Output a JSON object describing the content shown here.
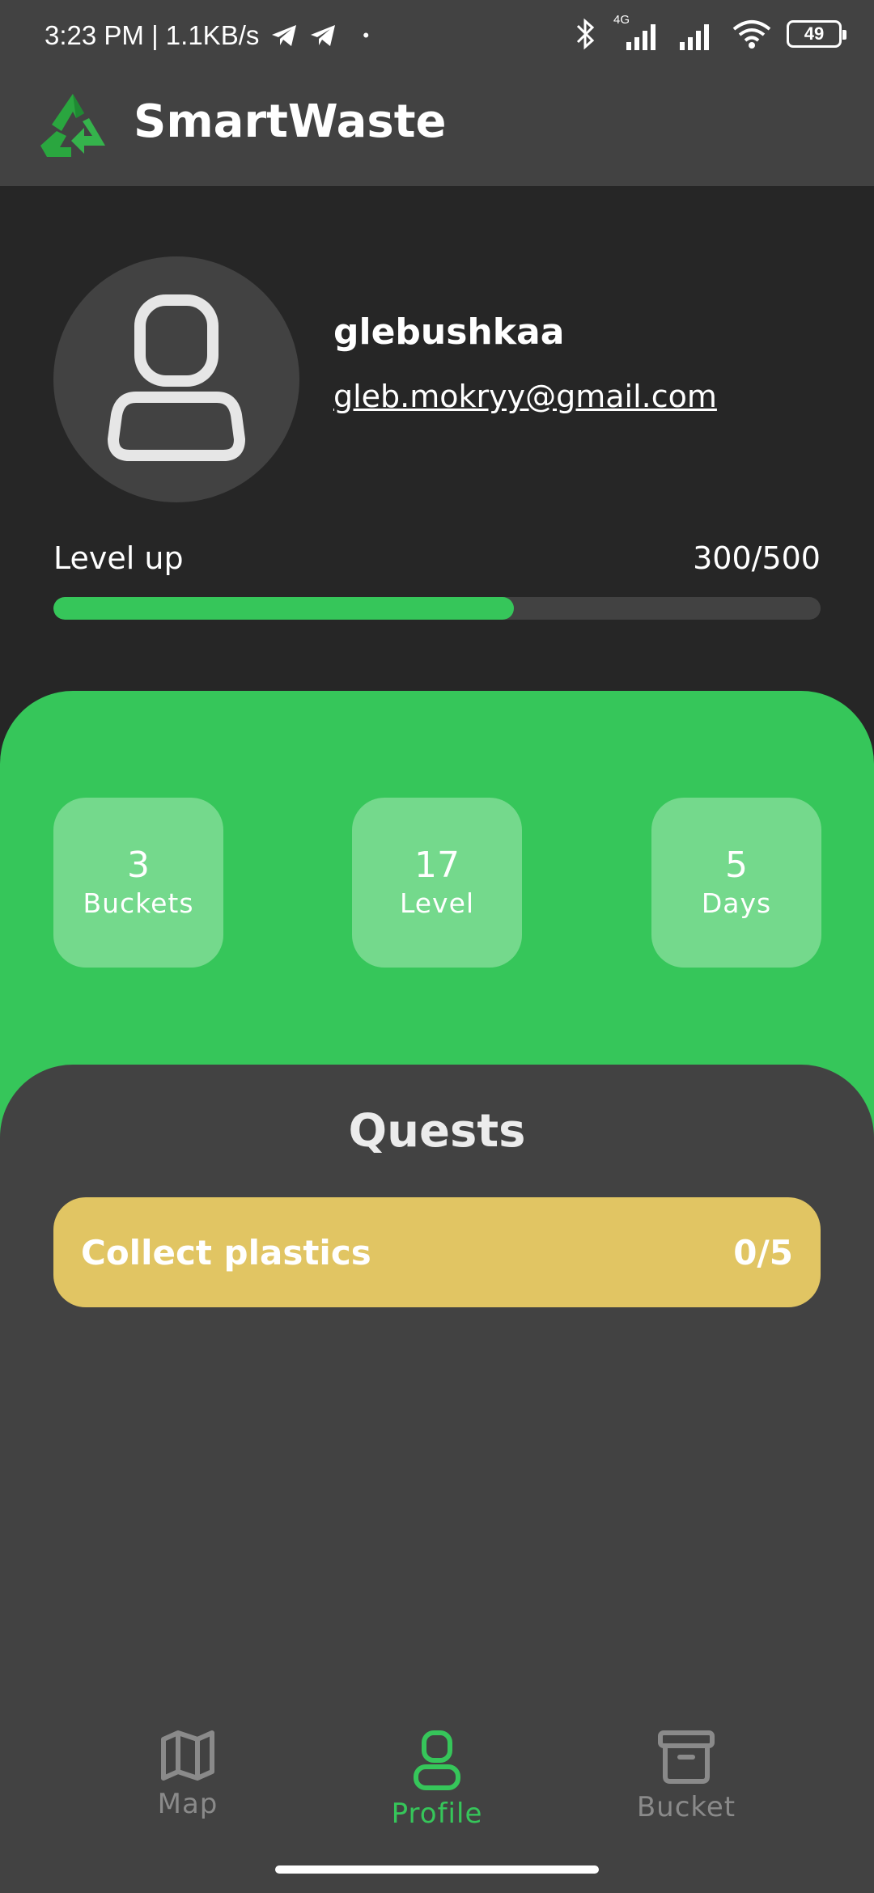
{
  "status_bar": {
    "time_speed": "3:23 PM | 1.1KB/s",
    "dot": "•",
    "network": "4G",
    "battery": "49",
    "icons": [
      "telegram-icon",
      "telegram-icon",
      "bluetooth-icon",
      "signal-icon",
      "signal-icon",
      "wifi-icon",
      "battery-icon"
    ]
  },
  "app_bar": {
    "title": "SmartWaste",
    "logo_icon": "recycle-icon"
  },
  "profile": {
    "username": "glebushkaa",
    "email": "gleb.mokryy@gmail.com",
    "avatar_icon": "user-icon"
  },
  "level": {
    "label": "Level up",
    "value_text": "300/500",
    "current": 300,
    "target": 500
  },
  "stats": [
    {
      "value": "3",
      "label": "Buckets"
    },
    {
      "value": "17",
      "label": "Level"
    },
    {
      "value": "5",
      "label": "Days"
    }
  ],
  "quests": {
    "title": "Quests",
    "items": [
      {
        "name": "Collect plastics",
        "progress": "0/5"
      }
    ]
  },
  "nav": {
    "items": [
      {
        "label": "Map",
        "icon": "map-icon",
        "active": false
      },
      {
        "label": "Profile",
        "icon": "user-icon",
        "active": true
      },
      {
        "label": "Bucket",
        "icon": "archive-box-icon",
        "active": false
      }
    ]
  },
  "colors": {
    "accent_green": "#36c65a",
    "stat_card": "#74d98c",
    "quest_yellow": "#e1c563",
    "surface": "#424242",
    "background": "#262626",
    "nav_inactive": "#8a8a8a"
  }
}
